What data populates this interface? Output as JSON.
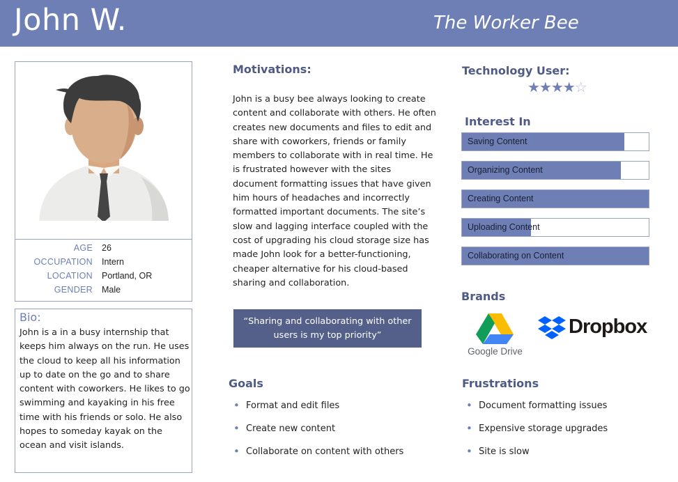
{
  "header": {
    "name": "John W.",
    "subtitle": "The Worker Bee"
  },
  "profile": {
    "avatar": "avatar-illustration",
    "info": [
      {
        "label": "AGE",
        "value": "26"
      },
      {
        "label": "OCCUPATION",
        "value": "Intern"
      },
      {
        "label": "LOCATION",
        "value": "Portland, OR"
      },
      {
        "label": "GENDER",
        "value": "Male"
      }
    ]
  },
  "bio": {
    "title": "Bio:",
    "text": "John is a in a busy internship that keeps him always on the run. He uses the cloud to keep all his information up to date on the go and to share content with coworkers. He likes to go swimming and kayaking in his free time with his friends or solo. He also hopes to someday kayak on the ocean and visit islands."
  },
  "motivations": {
    "title": "Motivations:",
    "text": "John is a busy bee always looking to create content and collaborate with others. He often creates new documents and files to edit and share with coworkers, friends or family members to collaborate with in real time. He is frustrated however with the sites document formatting issues that have given him hours of headaches and incorrectly formatted important documents. The site’s slow and lagging interface coupled with the cost of upgrading his cloud storage size has made John look for a better-functioning, cheaper alternative for his cloud-based sharing and collaboration."
  },
  "quote": "“Sharing and collaborating with other users is my top priority”",
  "goals": {
    "title": "Goals",
    "items": [
      "Format and edit files",
      "Create new content",
      "Collaborate on content with others"
    ]
  },
  "technology": {
    "title": "Technology User:",
    "rating": 4.5,
    "max": 5,
    "stars": "★★★★",
    "half_star": "☆"
  },
  "interests": {
    "title": "Interest In",
    "items": [
      {
        "label": "Saving Content",
        "level": 0.87
      },
      {
        "label": "Organizing Content",
        "level": 0.85
      },
      {
        "label": "Creating Content",
        "level": 1.0
      },
      {
        "label": "Uploading Content",
        "level": 0.37
      },
      {
        "label": "Collaborating on Content",
        "level": 1.0
      }
    ]
  },
  "brands": {
    "title": "Brands",
    "items": [
      {
        "name": "Google Drive",
        "icon": "google-drive-icon"
      },
      {
        "name": "Dropbox",
        "icon": "dropbox-icon"
      }
    ]
  },
  "frustrations": {
    "title": "Frustrations",
    "items": [
      "Document formatting issues",
      "Expensive storage upgrades",
      "Site is slow"
    ]
  },
  "colors": {
    "accent": "#6d7fb5",
    "heading": "#4f5a85",
    "quote_bg": "#55608a"
  }
}
